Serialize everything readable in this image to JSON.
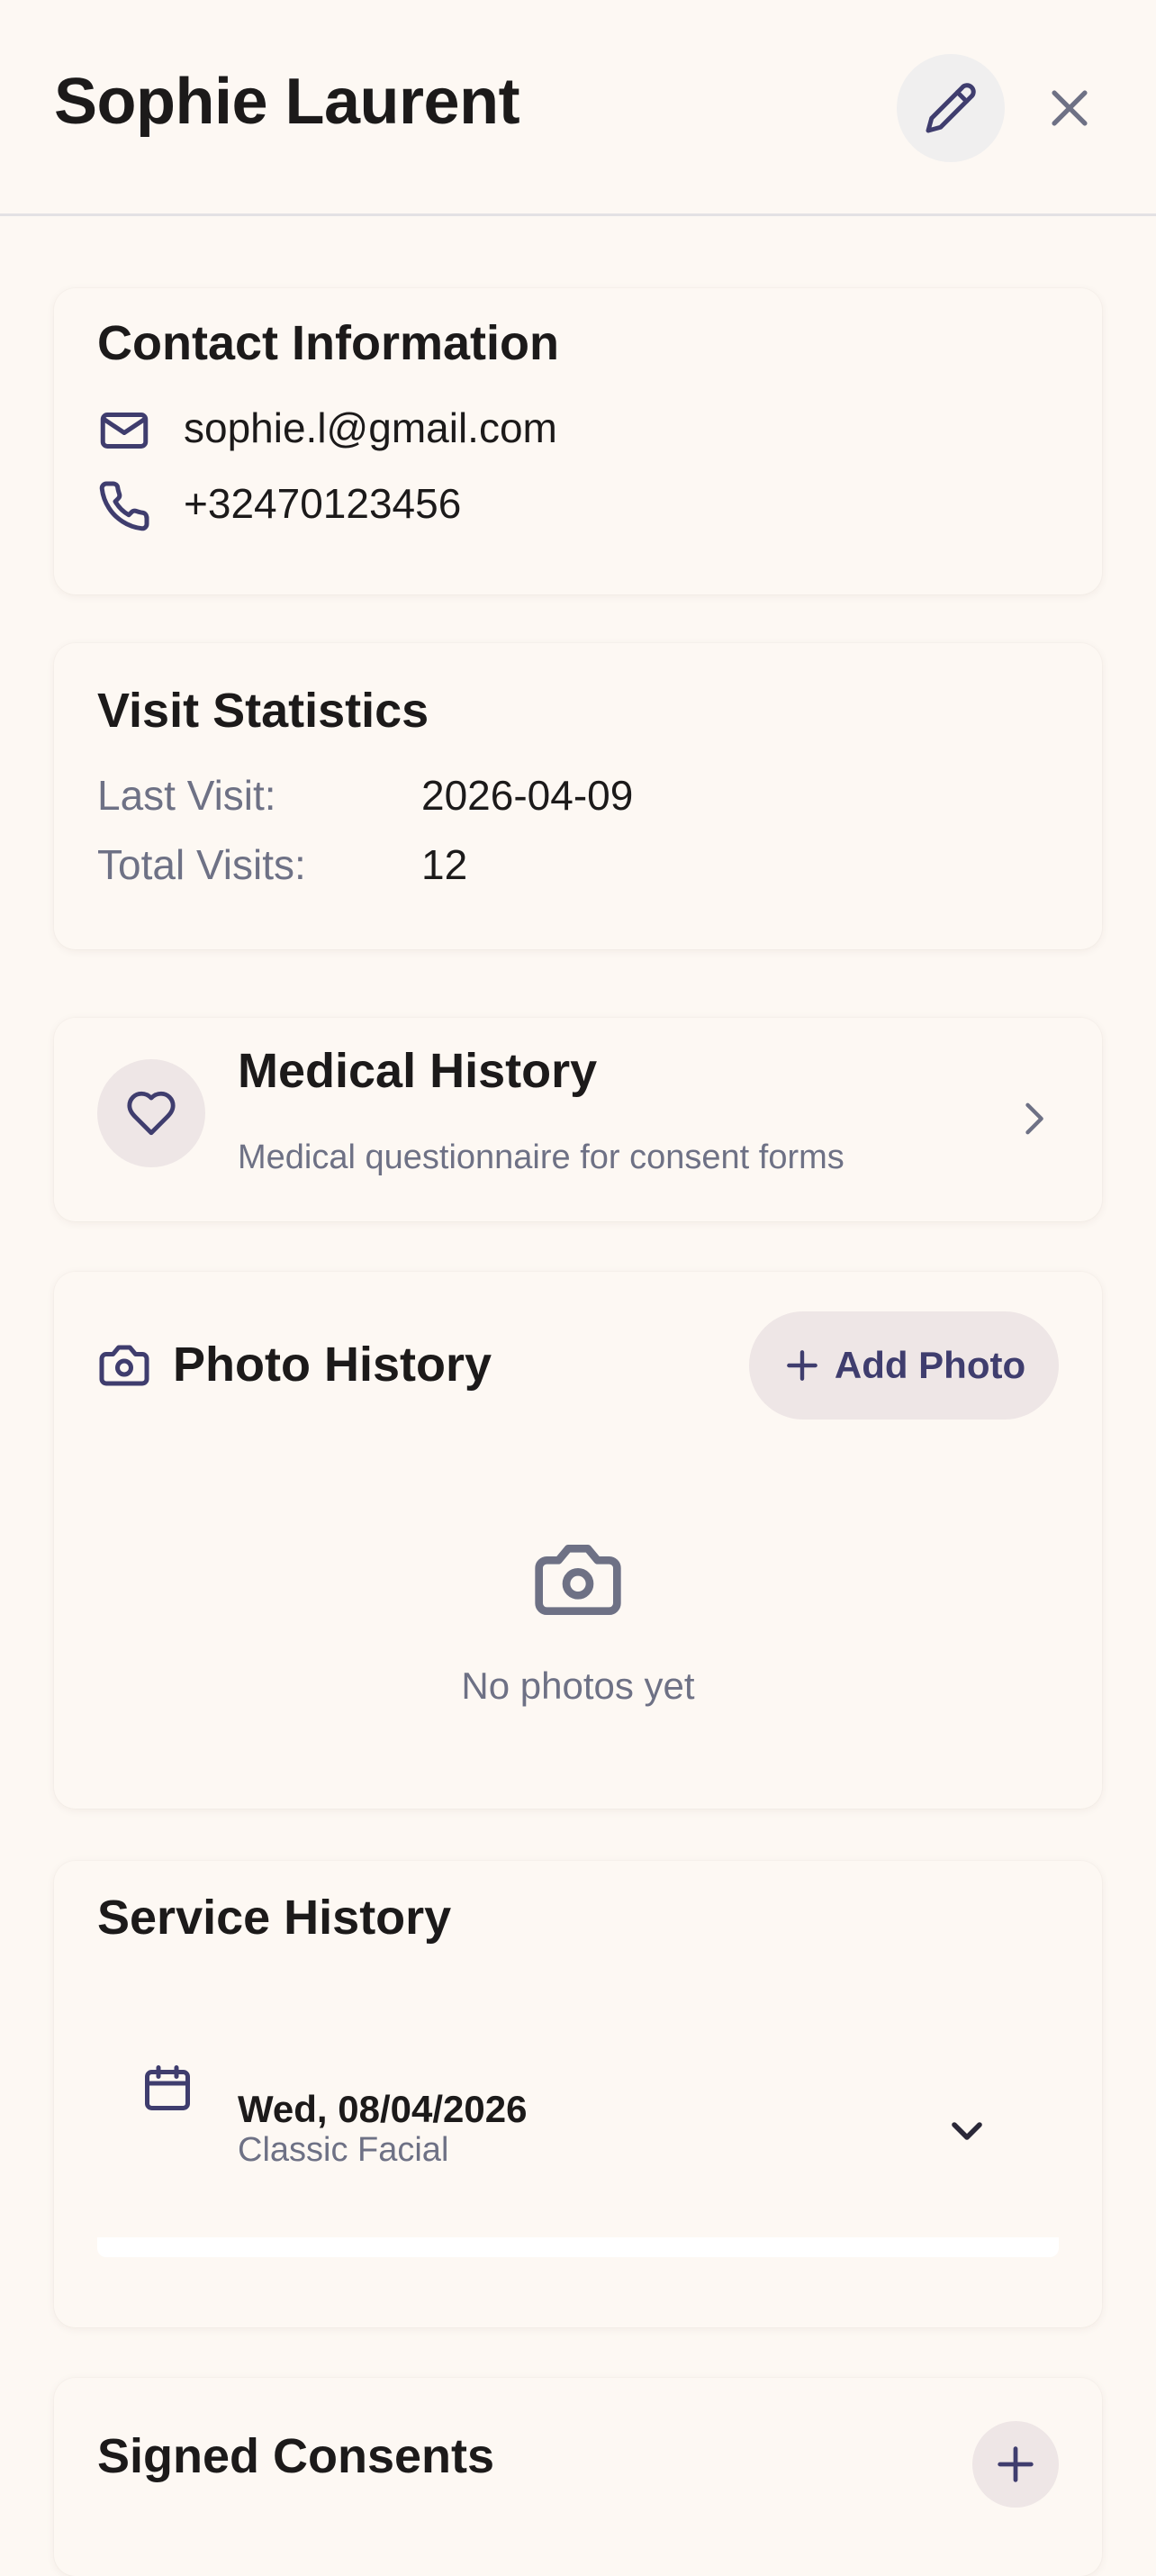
{
  "header": {
    "title": "Sophie Laurent",
    "edit_icon": "pencil-icon",
    "close_icon": "close-icon"
  },
  "contact": {
    "title": "Contact Information",
    "email": "sophie.l@gmail.com",
    "phone": "+32470123456",
    "email_icon": "mail-icon",
    "phone_icon": "phone-icon"
  },
  "visits": {
    "title": "Visit Statistics",
    "last_visit_label": "Last Visit:",
    "last_visit_value": "2026-04-09",
    "total_visits_label": "Total Visits:",
    "total_visits_value": "12"
  },
  "medical": {
    "title": "Medical History",
    "subtitle": "Medical questionnaire for consent forms",
    "icon": "heart-icon",
    "chevron": "chevron-right-icon"
  },
  "photos": {
    "title": "Photo History",
    "add_label": "Add Photo",
    "empty_text": "No photos yet",
    "icon": "camera-icon"
  },
  "services": {
    "title": "Service History",
    "items": [
      {
        "date": "Wed, 08/04/2026",
        "service": "Classic Facial"
      }
    ]
  },
  "consents": {
    "title": "Signed Consents"
  },
  "colors": {
    "background": "#fdf8f3",
    "accent": "#3f3d6e",
    "muted": "#6e7185",
    "chip": "#eee6e6"
  }
}
